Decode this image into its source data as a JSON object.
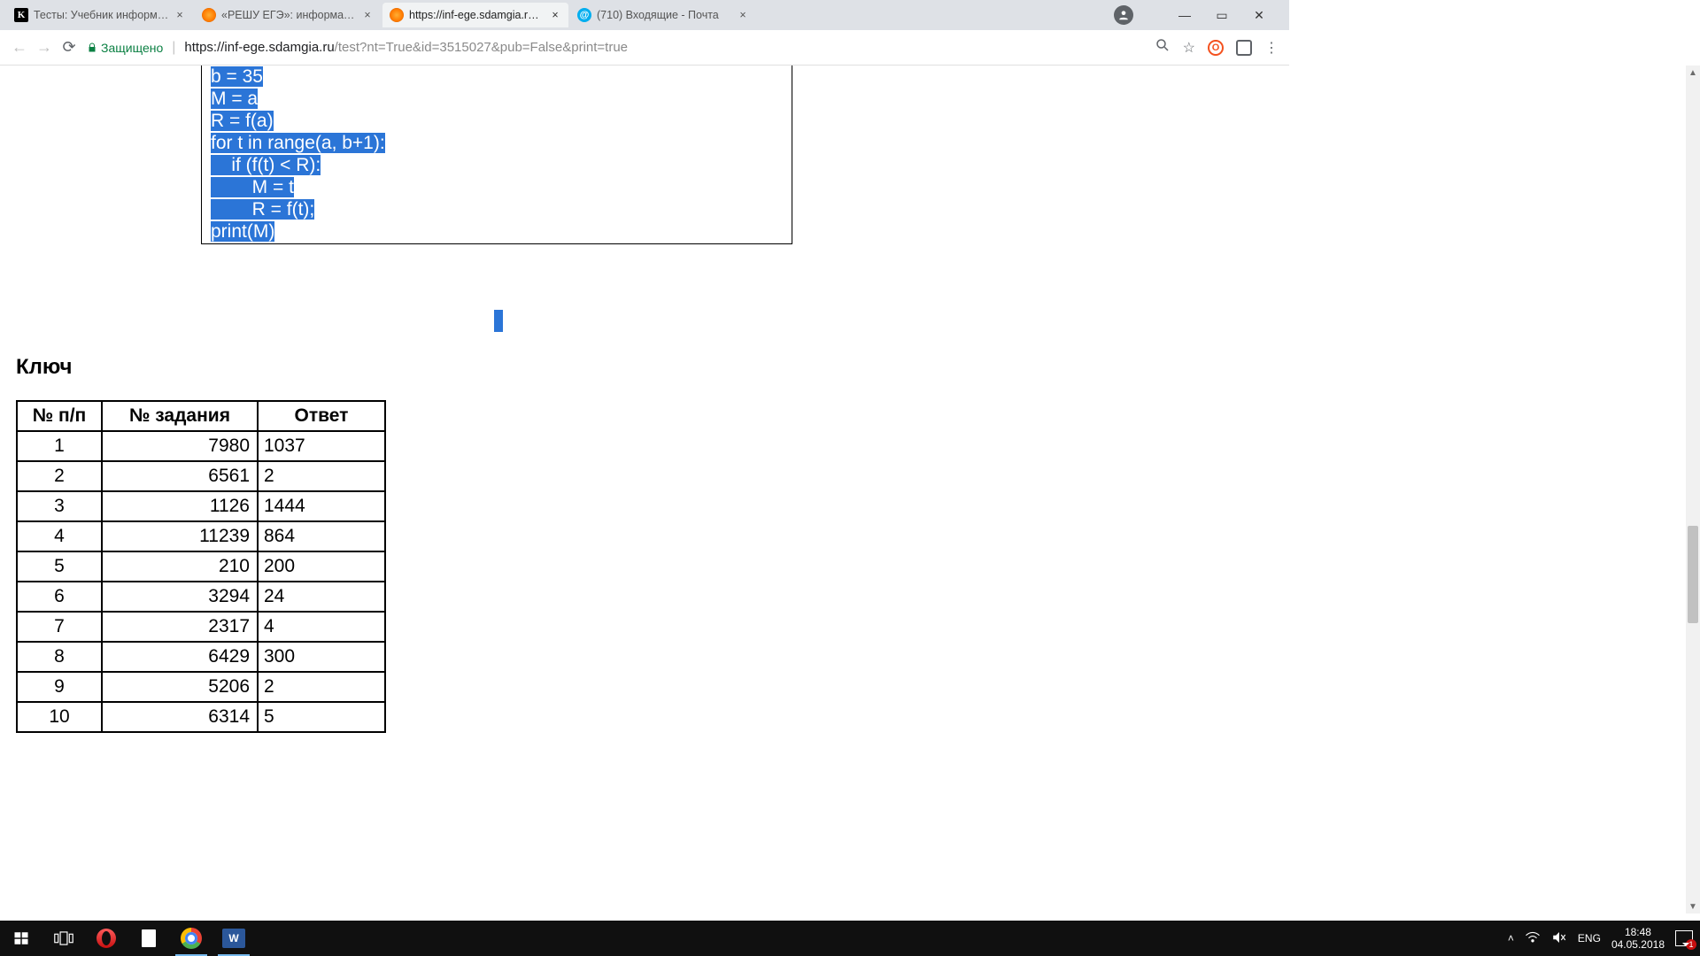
{
  "tabs": [
    {
      "title": "Тесты: Учебник информ…"
    },
    {
      "title": "«РЕШУ ЕГЭ»: информати…"
    },
    {
      "title": "https://inf-ege.sdamgia.r…"
    },
    {
      "title": "(710) Входящие - Почта"
    }
  ],
  "address": {
    "secure_label": "Защищено",
    "url_host": "https://inf-ege.sdamgia.ru",
    "url_path": "/test?nt=True&id=3515027&pub=False&print=true"
  },
  "code_lines": [
    "b = 35",
    "M = a",
    "R = f(a)",
    "for t in range(a, b+1):",
    "    if (f(t) < R):",
    "        M = t",
    "        R = f(t);",
    "print(M)"
  ],
  "key_heading": "Ключ",
  "table": {
    "headers": [
      "№ п/п",
      "№ задания",
      "Ответ"
    ],
    "rows": [
      {
        "n": "1",
        "task": "7980",
        "answer": "1037"
      },
      {
        "n": "2",
        "task": "6561",
        "answer": "2"
      },
      {
        "n": "3",
        "task": "1126",
        "answer": "1444"
      },
      {
        "n": "4",
        "task": "11239",
        "answer": "864"
      },
      {
        "n": "5",
        "task": "210",
        "answer": "200"
      },
      {
        "n": "6",
        "task": "3294",
        "answer": "24"
      },
      {
        "n": "7",
        "task": "2317",
        "answer": "4"
      },
      {
        "n": "8",
        "task": "6429",
        "answer": "300"
      },
      {
        "n": "9",
        "task": "5206",
        "answer": "2"
      },
      {
        "n": "10",
        "task": "6314",
        "answer": "5"
      }
    ]
  },
  "tray": {
    "lang": "ENG",
    "time": "18:48",
    "date": "04.05.2018",
    "notif_count": "1"
  }
}
